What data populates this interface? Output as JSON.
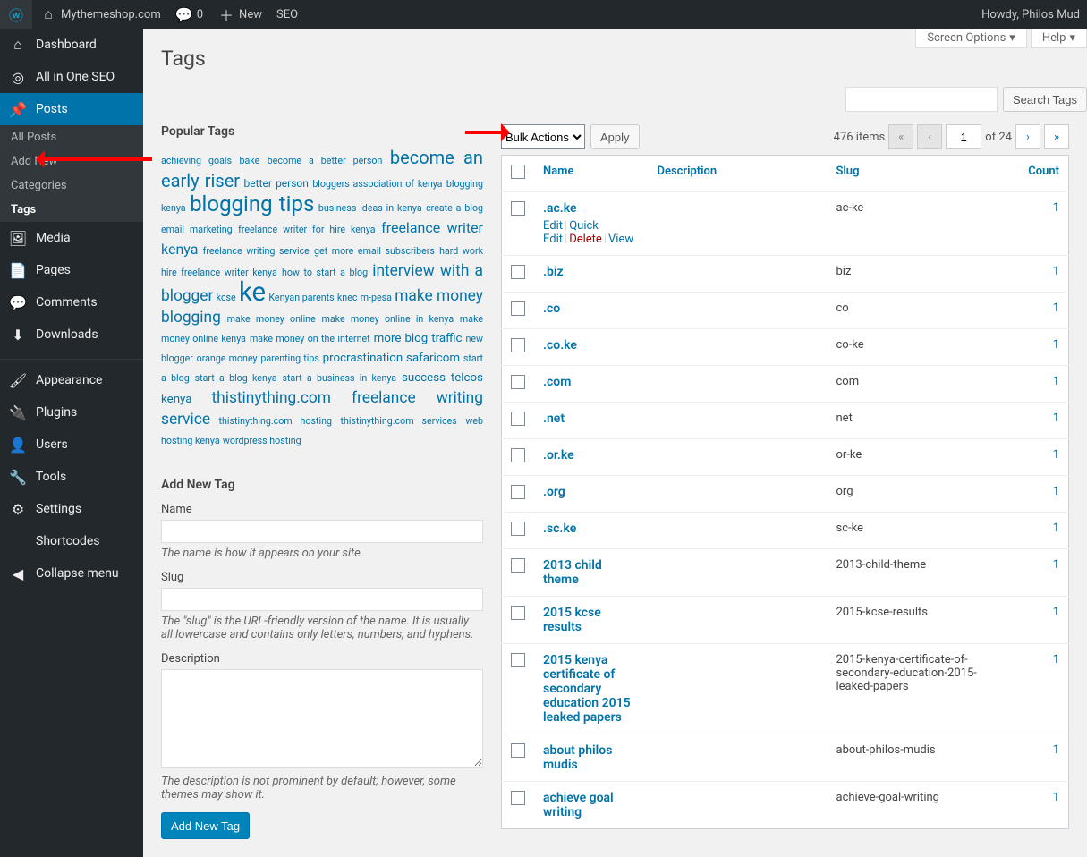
{
  "adminbar": {
    "site_name": "Mythemeshop.com",
    "comments_count": "0",
    "new_label": "New",
    "seo_label": "SEO",
    "howdy": "Howdy, Philos Mud"
  },
  "sidebar": {
    "items": [
      {
        "label": "Dashboard",
        "icon": "⌂"
      },
      {
        "label": "All in One SEO",
        "icon": "◎"
      },
      {
        "label": "Posts",
        "icon": "📌",
        "current": true,
        "submenu": [
          {
            "label": "All Posts"
          },
          {
            "label": "Add New"
          },
          {
            "label": "Categories"
          },
          {
            "label": "Tags",
            "current": true
          }
        ]
      },
      {
        "label": "Media",
        "icon": "🖼"
      },
      {
        "label": "Pages",
        "icon": "📄"
      },
      {
        "label": "Comments",
        "icon": "💬"
      },
      {
        "label": "Downloads",
        "icon": "⬇"
      },
      {
        "label": "Appearance",
        "icon": "🖌"
      },
      {
        "label": "Plugins",
        "icon": "🔌"
      },
      {
        "label": "Users",
        "icon": "👤"
      },
      {
        "label": "Tools",
        "icon": "🔧"
      },
      {
        "label": "Settings",
        "icon": "⚙"
      },
      {
        "label": "Shortcodes",
        "icon": "</>"
      },
      {
        "label": "Collapse menu",
        "icon": "◀"
      }
    ]
  },
  "screen": {
    "options": "Screen Options",
    "help": "Help"
  },
  "page_title": "Tags",
  "search": {
    "placeholder": "",
    "button": "Search Tags"
  },
  "popular_tags_heading": "Popular Tags",
  "popular_tags": [
    {
      "t": "achieving goals",
      "s": 8
    },
    {
      "t": "bake",
      "s": 8
    },
    {
      "t": "become a better person",
      "s": 8
    },
    {
      "t": "become an early riser",
      "s": 15
    },
    {
      "t": "better person",
      "s": 9
    },
    {
      "t": "bloggers association of kenya",
      "s": 8
    },
    {
      "t": "blogging kenya",
      "s": 8
    },
    {
      "t": "blogging tips",
      "s": 18
    },
    {
      "t": "business ideas in kenya",
      "s": 8
    },
    {
      "t": "create a blog",
      "s": 8
    },
    {
      "t": "email marketing",
      "s": 8
    },
    {
      "t": "freelance writer for hire kenya",
      "s": 8
    },
    {
      "t": "freelance writer kenya",
      "s": 12
    },
    {
      "t": "freelance writing service",
      "s": 8
    },
    {
      "t": "get more email subscribers",
      "s": 8
    },
    {
      "t": "hard work",
      "s": 8
    },
    {
      "t": "hire freelance writer kenya",
      "s": 8
    },
    {
      "t": "how to start a blog",
      "s": 8
    },
    {
      "t": "interview with a blogger",
      "s": 13
    },
    {
      "t": "kcse",
      "s": 8
    },
    {
      "t": "ke",
      "s": 22
    },
    {
      "t": "Kenyan parents",
      "s": 8
    },
    {
      "t": "knec",
      "s": 8
    },
    {
      "t": "m-pesa",
      "s": 8
    },
    {
      "t": "make money blogging",
      "s": 13
    },
    {
      "t": "make money online",
      "s": 8
    },
    {
      "t": "make money online in kenya",
      "s": 8
    },
    {
      "t": "make money online kenya",
      "s": 8
    },
    {
      "t": "make money on the internet",
      "s": 8
    },
    {
      "t": "more blog traffic",
      "s": 10
    },
    {
      "t": "new blogger",
      "s": 8
    },
    {
      "t": "orange money",
      "s": 8
    },
    {
      "t": "parenting tips",
      "s": 8
    },
    {
      "t": "procrastination",
      "s": 10
    },
    {
      "t": "safaricom",
      "s": 10
    },
    {
      "t": "start a blog",
      "s": 8
    },
    {
      "t": "start a blog kenya",
      "s": 8
    },
    {
      "t": "start a business in kenya",
      "s": 8
    },
    {
      "t": "success",
      "s": 10
    },
    {
      "t": "telcos kenya",
      "s": 10
    },
    {
      "t": "thistinything.com freelance writing service",
      "s": 13
    },
    {
      "t": "thistinything.com hosting",
      "s": 8
    },
    {
      "t": "thistinything.com services",
      "s": 8
    },
    {
      "t": "web hosting kenya",
      "s": 8
    },
    {
      "t": "wordpress hosting",
      "s": 8
    }
  ],
  "form": {
    "heading": "Add New Tag",
    "name_label": "Name",
    "name_desc": "The name is how it appears on your site.",
    "slug_label": "Slug",
    "slug_desc": "The \"slug\" is the URL-friendly version of the name. It is usually all lowercase and contains only letters, numbers, and hyphens.",
    "desc_label": "Description",
    "desc_desc": "The description is not prominent by default; however, some themes may show it.",
    "submit": "Add New Tag"
  },
  "bulk": {
    "label": "Bulk Actions",
    "apply": "Apply"
  },
  "pagination": {
    "items": "476 items",
    "current": "1",
    "of": "of 24"
  },
  "columns": {
    "name": "Name",
    "description": "Description",
    "slug": "Slug",
    "count": "Count"
  },
  "row_actions": {
    "edit": "Edit",
    "quick": "Quick Edit",
    "delete": "Delete",
    "view": "View"
  },
  "rows": [
    {
      "name": ".ac.ke",
      "slug": "ac-ke",
      "count": "1",
      "show_actions": true
    },
    {
      "name": ".biz",
      "slug": "biz",
      "count": "1"
    },
    {
      "name": ".co",
      "slug": "co",
      "count": "1"
    },
    {
      "name": ".co.ke",
      "slug": "co-ke",
      "count": "1"
    },
    {
      "name": ".com",
      "slug": "com",
      "count": "1"
    },
    {
      "name": ".net",
      "slug": "net",
      "count": "1"
    },
    {
      "name": ".or.ke",
      "slug": "or-ke",
      "count": "1"
    },
    {
      "name": ".org",
      "slug": "org",
      "count": "1"
    },
    {
      "name": ".sc.ke",
      "slug": "sc-ke",
      "count": "1"
    },
    {
      "name": "2013 child theme",
      "slug": "2013-child-theme",
      "count": "1"
    },
    {
      "name": "2015 kcse results",
      "slug": "2015-kcse-results",
      "count": "1"
    },
    {
      "name": "2015 kenya certificate of secondary education 2015 leaked papers",
      "slug": "2015-kenya-certificate-of-secondary-education-2015-leaked-papers",
      "count": "1"
    },
    {
      "name": "about philos mudis",
      "slug": "about-philos-mudis",
      "count": "1"
    },
    {
      "name": "achieve goal writing",
      "slug": "achieve-goal-writing",
      "count": "1"
    }
  ]
}
